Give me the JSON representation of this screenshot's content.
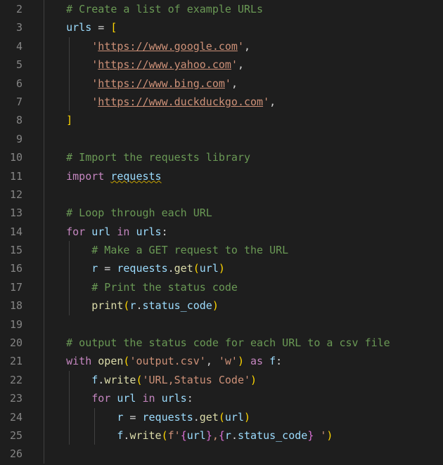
{
  "lines": {
    "start": 2,
    "end": 26
  },
  "code": {
    "c_create": "# Create a list of example URLs",
    "urls_var": "urls",
    "eq": " = ",
    "lbrack": "[",
    "url1": "https://www.google.com",
    "url2": "https://www.yahoo.com",
    "url3": "https://www.bing.com",
    "url4": "https://www.duckduckgo.com",
    "rbrack": "]",
    "c_import": "# Import the requests library",
    "kw_import": "import",
    "mod_requests": "requests",
    "c_loop": "# Loop through each URL",
    "kw_for": "for",
    "var_url": "url",
    "kw_in": "in",
    "var_urls": "urls",
    "colon": ":",
    "c_get": "# Make a GET request to the URL",
    "var_r": "r",
    "dot": ".",
    "fn_get": "get",
    "c_print": "# Print the status code",
    "fn_print": "print",
    "attr_status": "status_code",
    "c_output": "# output the status code for each URL to a csv file",
    "kw_with": "with",
    "fn_open": "open",
    "s_outcsv": "'output.csv'",
    "s_w": "'w'",
    "kw_as": "as",
    "var_f": "f",
    "fn_write": "write",
    "s_header": "'URL,Status Code'",
    "fs_prefix": "f'",
    "fs_open": "{",
    "fs_close": "}",
    "fs_comma": ",",
    "fs_tail": " '",
    "q": "'",
    "comma": ",",
    "sp": " ",
    "lpar": "(",
    "rpar": ")"
  }
}
